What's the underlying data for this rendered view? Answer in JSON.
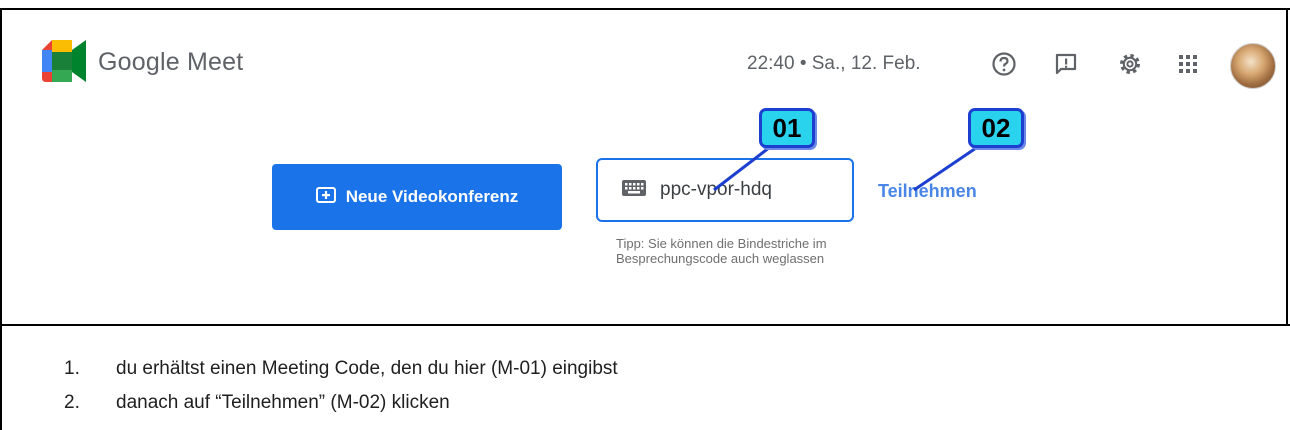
{
  "brand": {
    "name": "Google Meet"
  },
  "header": {
    "datetime": "22:40 • Sa., 12. Feb.",
    "icons": [
      "help-icon",
      "feedback-icon",
      "settings-icon",
      "apps-grid-icon",
      "avatar"
    ]
  },
  "actions": {
    "new_meeting_label": "Neue Videokonferenz",
    "code_value": "ppc-vpor-hdq",
    "join_label": "Teilnehmen",
    "tip": "Tipp: Sie können die Bindestriche im Besprechungscode auch weglassen"
  },
  "markers": {
    "m1": "01",
    "m2": "02"
  },
  "instructions": [
    {
      "num": "1.",
      "text": "du erhältst einen Meeting Code, den du hier (M-01) eingibst"
    },
    {
      "num": "2.",
      "text": "danach auf “Teilnehmen” (M-02) klicken"
    }
  ],
  "colors": {
    "primary": "#1a73e8",
    "marker_fill": "#29d3ee",
    "marker_border": "#1d3fd0"
  }
}
